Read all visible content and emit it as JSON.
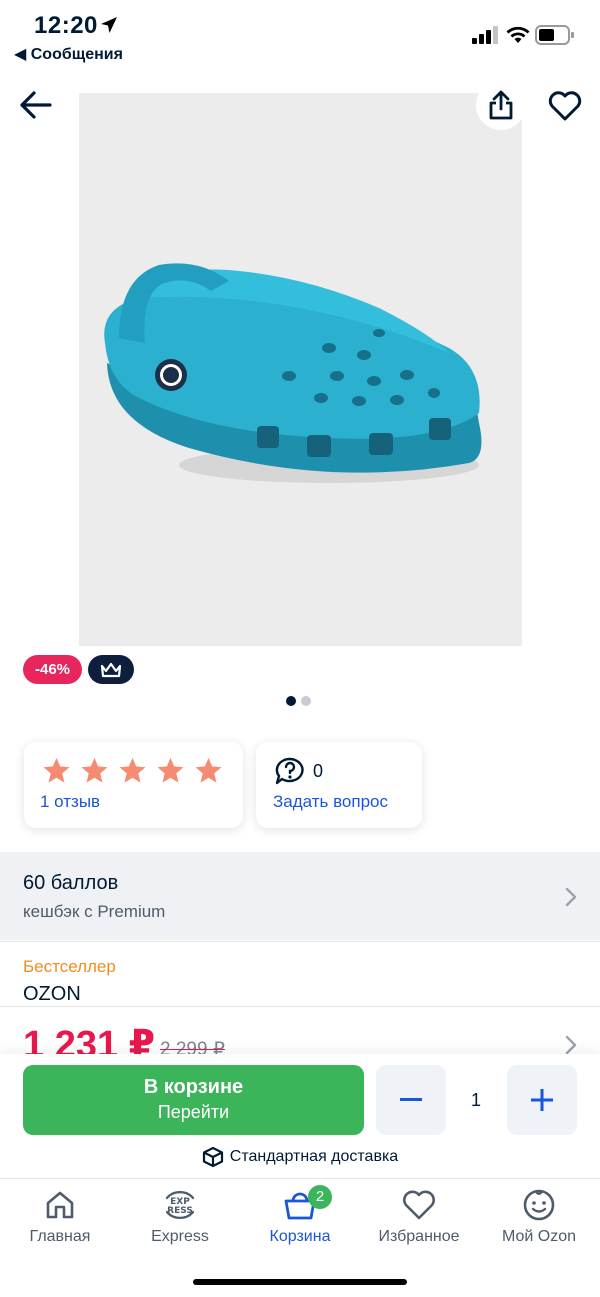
{
  "status_bar": {
    "time": "12:20",
    "back_app": "◀ Сообщения"
  },
  "product": {
    "image_alt": "Crocs clog",
    "discount_badge": "-46%",
    "premium_icon": "crown-icon",
    "gallery_pages": 2,
    "gallery_active": 1
  },
  "rating": {
    "stars": 5,
    "reviews_link": "1 отзыв",
    "questions_count": "0",
    "ask_link": "Задать вопрос"
  },
  "cashback": {
    "title": "60 баллов",
    "subtitle": "кешбэк с Premium"
  },
  "seller": {
    "tag": "Бестселлер",
    "name": "OZON"
  },
  "price": {
    "current": "1 231 ₽",
    "old": "2 299 ₽"
  },
  "cart_action": {
    "title": "В корзине",
    "subtitle": "Перейти",
    "quantity": "1",
    "delivery": "Стандартная доставка"
  },
  "tabs": [
    {
      "label": "Главная",
      "icon": "home-icon"
    },
    {
      "label": "Express",
      "icon": "express-icon"
    },
    {
      "label": "Корзина",
      "icon": "cart-icon",
      "badge": "2"
    },
    {
      "label": "Избранное",
      "icon": "heart-icon"
    },
    {
      "label": "Мой Ozon",
      "icon": "profile-icon"
    }
  ],
  "colors": {
    "accent_blue": "#1a56db",
    "discount_red": "#e8265e",
    "cart_green": "#3cb55a",
    "star": "#f58b73",
    "bestseller": "#f28c1e"
  }
}
